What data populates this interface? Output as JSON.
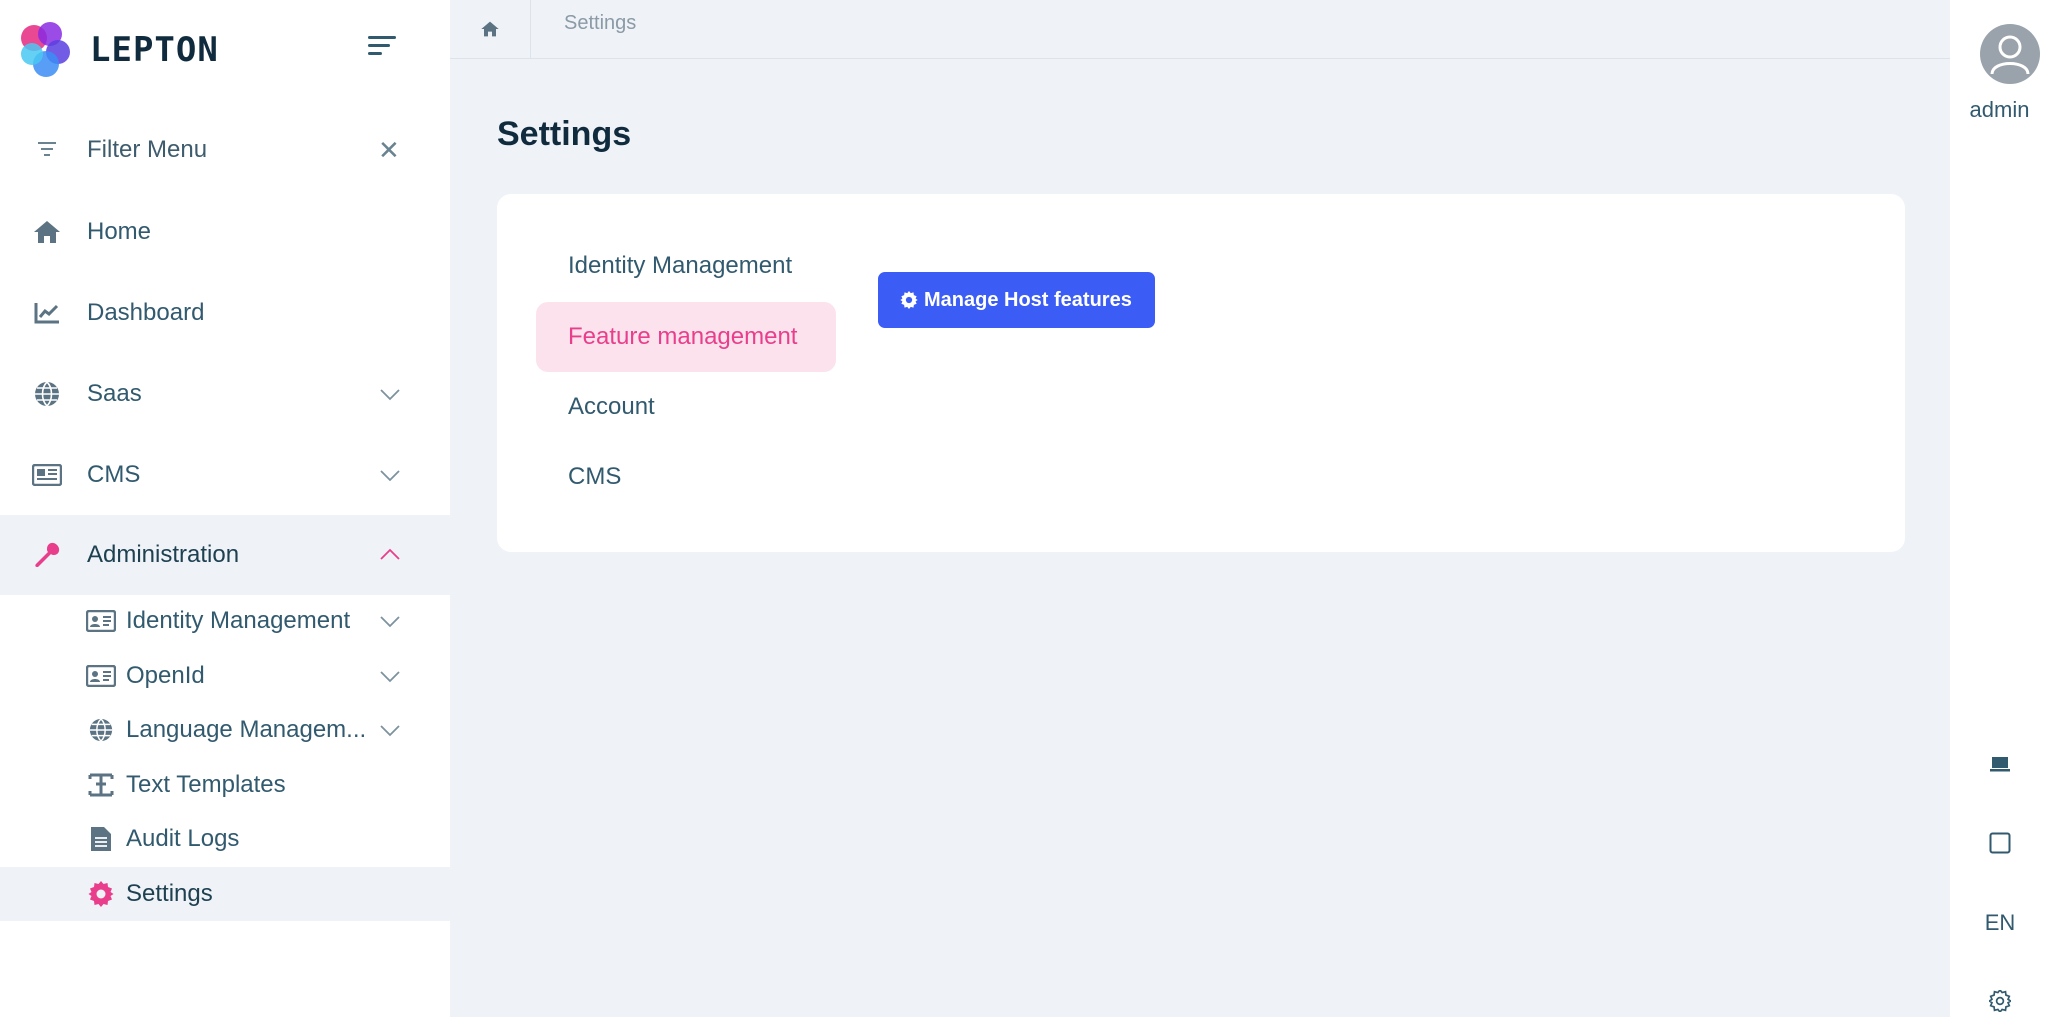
{
  "brand": {
    "name": "LEPTON"
  },
  "sidebar": {
    "filter_label": "Filter Menu",
    "items": [
      {
        "label": "Home",
        "icon": "home-icon"
      },
      {
        "label": "Dashboard",
        "icon": "chart-line-icon"
      },
      {
        "label": "Saas",
        "icon": "globe-icon"
      },
      {
        "label": "CMS",
        "icon": "newspaper-icon"
      },
      {
        "label": "Administration",
        "icon": "wrench-icon"
      }
    ],
    "sub_items": [
      {
        "label": "Identity Management",
        "icon": "id-card-icon"
      },
      {
        "label": "OpenId",
        "icon": "id-card-icon"
      },
      {
        "label": "Language Managem...",
        "icon": "globe-icon"
      },
      {
        "label": "Text Templates",
        "icon": "text-template-icon"
      },
      {
        "label": "Audit Logs",
        "icon": "file-text-icon"
      },
      {
        "label": "Settings",
        "icon": "gear-icon"
      }
    ]
  },
  "breadcrumb": {
    "current": "Settings"
  },
  "page": {
    "title": "Settings"
  },
  "settings": {
    "tabs": [
      "Identity Management",
      "Feature management",
      "Account",
      "CMS"
    ],
    "active_tab": "Feature management",
    "manage_button": "Manage Host features"
  },
  "user": {
    "name": "admin"
  },
  "rail": {
    "language": "EN"
  },
  "colors": {
    "accent": "#e83e8c",
    "primary_button": "#3b5cf5",
    "text": "#325a6f",
    "background": "#eff2f6"
  }
}
